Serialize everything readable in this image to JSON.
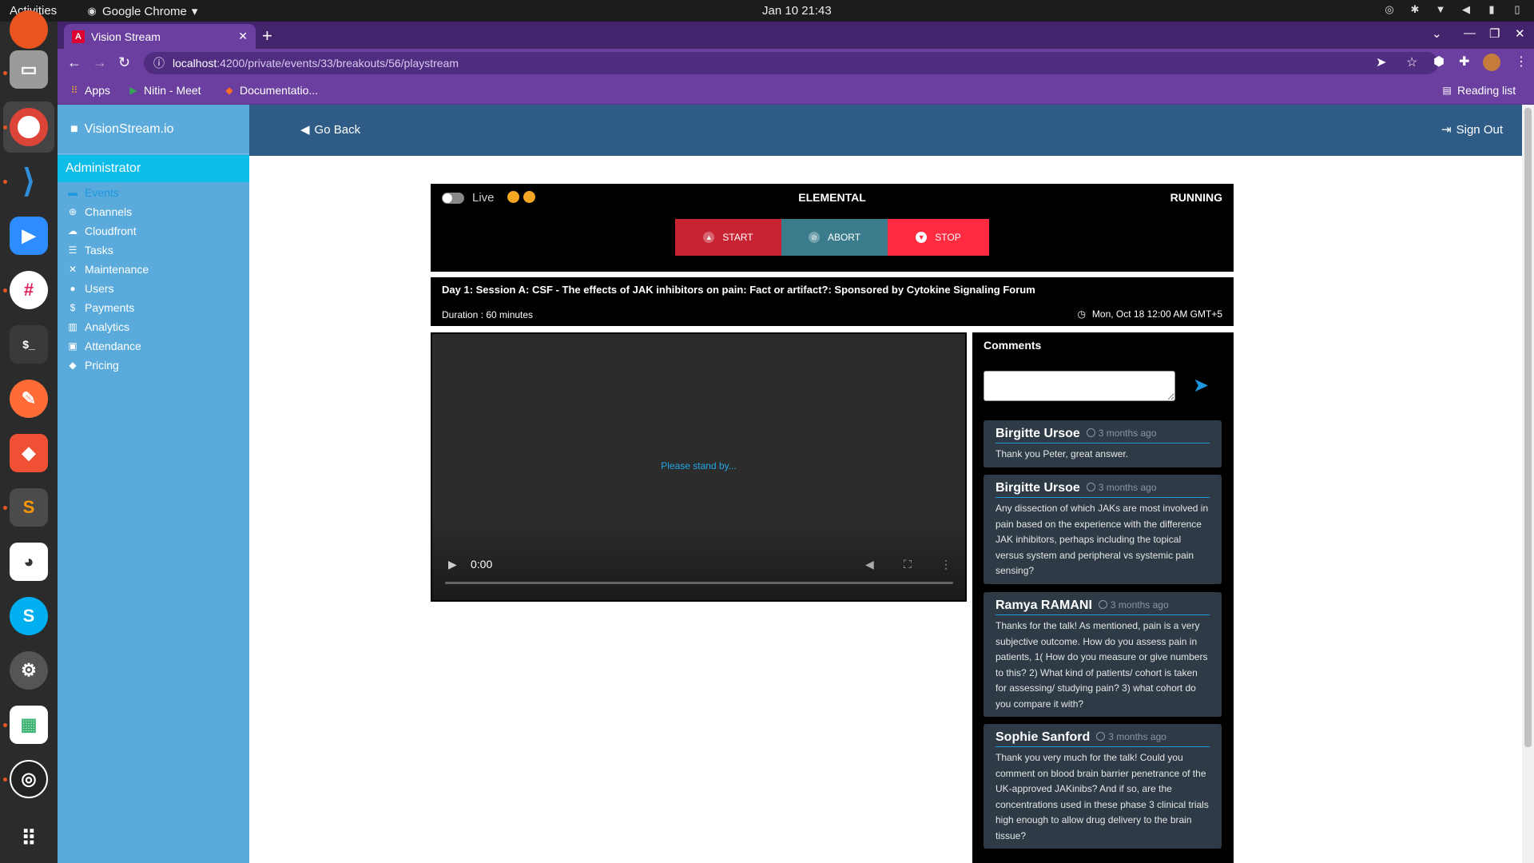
{
  "os": {
    "activities": "Activities",
    "app_name": "Google Chrome",
    "clock": "Jan 10  21:43"
  },
  "browser": {
    "tab_title": "Vision Stream",
    "tab_favicon": "A",
    "url_host": "localhost",
    "url_path": ":4200/private/events/33/breakouts/56/playstream",
    "bookmarks": [
      "Apps",
      "Nitin - Meet",
      "Documentatio..."
    ],
    "reading_list": "Reading list"
  },
  "app": {
    "brand": "VisionStream.io",
    "role": "Administrator",
    "menu": [
      {
        "label": "Events",
        "icon": "folder-icon",
        "glyph": "▬",
        "active": true
      },
      {
        "label": "Channels",
        "icon": "plus-circle-icon",
        "glyph": "⊕"
      },
      {
        "label": "Cloudfront",
        "icon": "cloud-icon",
        "glyph": "☁"
      },
      {
        "label": "Tasks",
        "icon": "list-icon",
        "glyph": "☰"
      },
      {
        "label": "Maintenance",
        "icon": "tools-icon",
        "glyph": "✕"
      },
      {
        "label": "Users",
        "icon": "user-icon",
        "glyph": "●"
      },
      {
        "label": "Payments",
        "icon": "dollar-icon",
        "glyph": "$"
      },
      {
        "label": "Analytics",
        "icon": "chart-icon",
        "glyph": "▥"
      },
      {
        "label": "Attendance",
        "icon": "calendar-icon",
        "glyph": "▣"
      },
      {
        "label": "Pricing",
        "icon": "tags-icon",
        "glyph": "◆"
      }
    ],
    "header": {
      "go_back": "Go Back",
      "sign_out": "Sign Out"
    }
  },
  "player": {
    "live_label": "Live",
    "encoder": "ELEMENTAL",
    "status": "RUNNING",
    "buttons": {
      "start": "START",
      "abort": "ABORT",
      "stop": "STOP"
    },
    "colors": {
      "start": "#c82333",
      "abort": "#3a7c8c",
      "stop": "#ff2b40",
      "indicator": "#f5a623"
    },
    "session_title": "Day 1: Session A: CSF - The effects of JAK inhibitors on pain: Fact or artifact?: Sponsored by Cytokine Signaling Forum",
    "duration": "Duration : 60 minutes",
    "date": "Mon, Oct 18 12:00 AM GMT+5",
    "standby": "Please stand by...",
    "time": "0:00"
  },
  "comments": {
    "title": "Comments",
    "items": [
      {
        "author": "Birgitte Ursoe",
        "time": "3 months ago",
        "text": "Thank you Peter, great answer."
      },
      {
        "author": "Birgitte Ursoe",
        "time": "3 months ago",
        "text": "Any dissection of which JAKs are most involved in pain based on the experience with the difference JAK inhibitors, perhaps including the topical versus system and peripheral vs systemic pain sensing?"
      },
      {
        "author": "Ramya RAMANI",
        "time": "3 months ago",
        "text": "Thanks for the talk! As mentioned, pain is a very subjective outcome. How do you assess pain in patients, 1( How do you measure or give numbers to this? 2) What kind of patients/ cohort is taken for assessing/ studying pain? 3) what cohort do you compare it with?"
      },
      {
        "author": "Sophie Sanford",
        "time": "3 months ago",
        "text": "Thank you very much for the talk! Could you comment on blood brain barrier penetrance of the UK-approved JAKinibs? And if so, are the concentrations used in these phase 3 clinical trials high enough to allow drug delivery to the brain tissue?"
      }
    ]
  }
}
